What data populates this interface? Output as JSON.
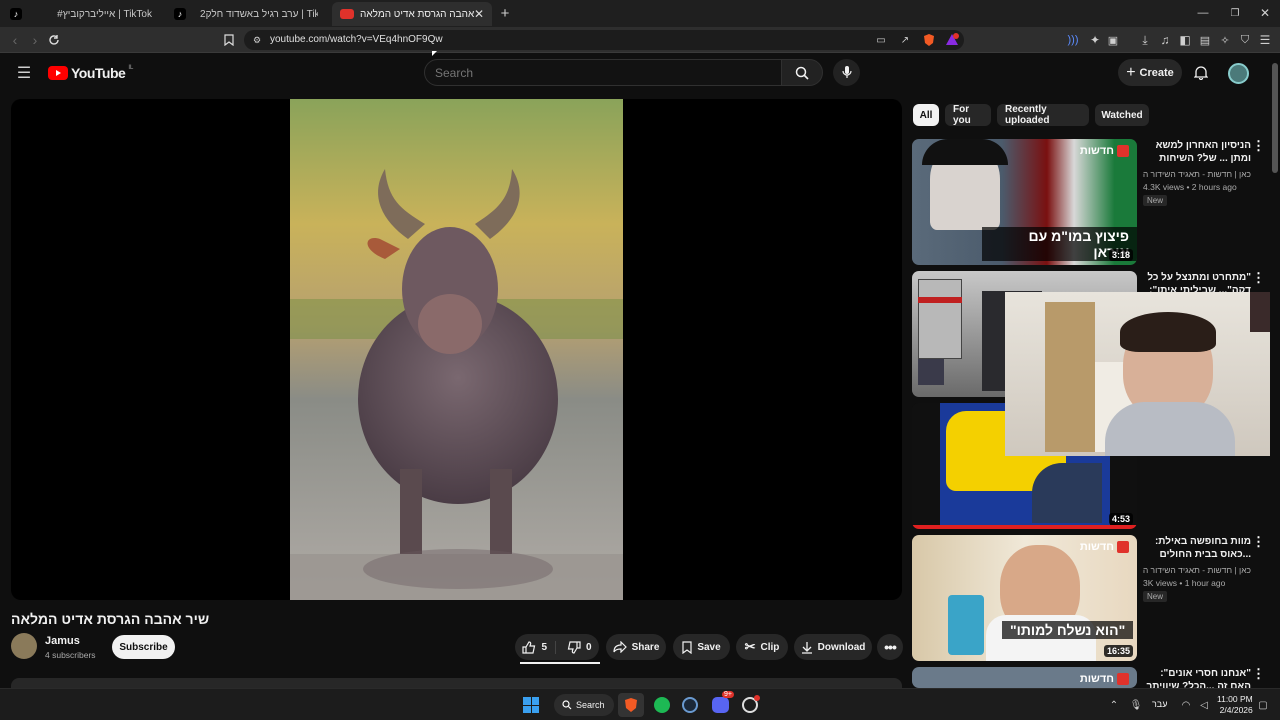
{
  "browser": {
    "tabs": [
      {
        "title": "#אייליברקוביץ | TikTok",
        "icon": "tiktok-icon"
      },
      {
        "title": "ערב רגיל באשדוד חלק2 | TikTok",
        "icon": "tiktok-icon"
      },
      {
        "title": "שיר אהבה הגרסת אדיט המלאה",
        "icon": "youtube-icon"
      }
    ],
    "url": "youtube.com/watch?v=VEq4hnOF9Qw"
  },
  "youtube": {
    "logo": "YouTube",
    "region": "IL",
    "search_placeholder": "Search",
    "create_label": "Create"
  },
  "video": {
    "title": "שיר אהבה הגרסת אדיט המלאה",
    "channel": "Jamus",
    "subscribers": "4 subscribers",
    "subscribe_label": "Subscribe",
    "likes": "5",
    "dislikes": "0",
    "share_label": "Share",
    "save_label": "Save",
    "clip_label": "Clip",
    "download_label": "Download"
  },
  "filters": [
    "All",
    "For you",
    "Recently uploaded",
    "Watched"
  ],
  "recommendations": [
    {
      "title": "הניסיון האחרון למשא ומתן ... של? השיחות האמריקניות",
      "channel": "כאן | חדשות - תאגיד השידור הישרא...",
      "meta": "4.3K views • 2 hours ago",
      "badge": "New",
      "duration": "3:18",
      "overlay": "פיצוץ במו\"מ עם איראן",
      "logo": "חדשות"
    },
    {
      "title": "\"מתחרט ומתנצל על כל דקה\"... שביליתי איתו\": מסמכי",
      "channel": "",
      "meta": "",
      "badge": "",
      "duration": "",
      "overlay": "",
      "logo": ""
    },
    {
      "title": "",
      "channel": "",
      "meta": "",
      "badge": "",
      "duration": "4:53",
      "overlay": "",
      "logo": ""
    },
    {
      "title": "מוות בחופשה באילת: ...כאוס בבית החולים יוספטל",
      "channel": "כאן | חדשות - תאגיד השידור הישרא...",
      "meta": "3K views • 1 hour ago",
      "badge": "New",
      "duration": "16:35",
      "overlay": "\"הוא נשלח למותו\"",
      "logo": "חדשות"
    },
    {
      "title": "\"אנחנו חסרי אונים\": האם זה ...הכל? שיוויתר את תקיפת",
      "channel": "",
      "meta": "",
      "badge": "",
      "duration": "",
      "overlay": "",
      "logo": "חדשות"
    }
  ],
  "taskbar": {
    "search_label": "Search",
    "language": "עבר",
    "time": "11:00 PM",
    "date": "2/4/2026",
    "discord_badge": "9+"
  }
}
